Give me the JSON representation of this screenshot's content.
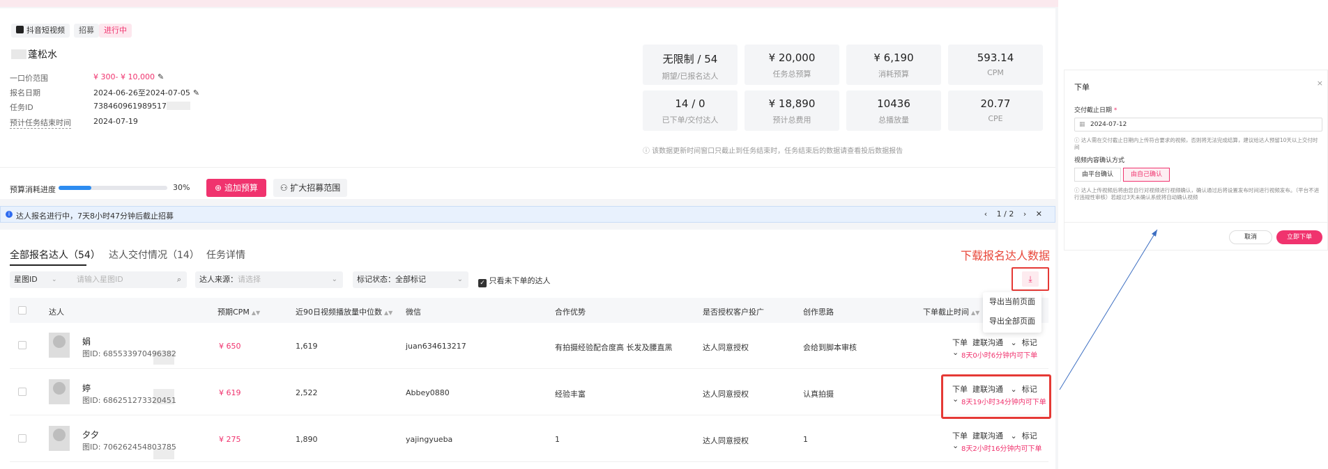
{
  "task": {
    "platform_tag": "抖音短视频",
    "recruit_tag": "招募",
    "status_tag": "进行中",
    "title": "蓬松水",
    "fields": [
      {
        "label": "一口价范围",
        "value": "¥ 300- ¥ 10,000"
      },
      {
        "label": "报名日期",
        "value": "2024-06-26至2024-07-05"
      },
      {
        "label": "任务ID",
        "value": "738460961989517"
      },
      {
        "label": "预计任务结束时间",
        "value": "2024-07-19"
      }
    ]
  },
  "metrics": [
    {
      "value": "无限制 / 54",
      "label": "期望/已报名达人"
    },
    {
      "value": "¥ 20,000",
      "label": "任务总预算"
    },
    {
      "value": "¥ 6,190",
      "label": "消耗预算"
    },
    {
      "value": "593.14",
      "label": "CPM"
    },
    {
      "value": "14 / 0",
      "label": "已下单/交付达人"
    },
    {
      "value": "¥ 18,890",
      "label": "预计总费用"
    },
    {
      "value": "10436",
      "label": "总播放量"
    },
    {
      "value": "20.77",
      "label": "CPE"
    }
  ],
  "metrics_note": "ⓘ 该数据更新时间窗口只截止到任务结束时，任务结束后的数据请查看投后数据报告",
  "progress": {
    "label": "预算消耗进度",
    "percent_value": 30,
    "percent_text": "30%",
    "add_budget_label": "追加预算",
    "expand_label": "扩大招募范围"
  },
  "banner": {
    "text": "达人报名进行中，7天8小时47分钟后截止招募",
    "pager": "1 / 2",
    "prev": "‹",
    "next": "›",
    "close": "✕"
  },
  "tabs": [
    {
      "label": "全部报名达人（54）"
    },
    {
      "label": "达人交付情况（14）"
    },
    {
      "label": "任务详情"
    }
  ],
  "annotation_download": "下载报名达人数据",
  "filters": {
    "star_select": "星图ID",
    "star_placeholder": "请输入星图ID",
    "source_label": "达人来源：",
    "source_placeholder": "请选择",
    "mark_label": "标记状态：全部标记",
    "only_unordered": "只看未下单的达人"
  },
  "export_menu": [
    "导出当前页面",
    "导出全部页面"
  ],
  "columns": [
    "达人",
    "预期CPM",
    "近90日视频播放量中位数",
    "微信",
    "合作优势",
    "是否授权客户投广",
    "创作思路",
    "下单截止时间"
  ],
  "rows": [
    {
      "name": "娟",
      "star_id": "图ID: 685533970496382",
      "cpm": "¥ 650",
      "plays": "1,619",
      "wechat": "juan634613217",
      "advantage": "有拍摄经验配合度高 长发及腰直黑",
      "auth": "达人同意授权",
      "idea": "会给到脚本审核",
      "countdown": "8天0小时6分钟内可下单"
    },
    {
      "name": "婷",
      "star_id": "图ID: 686251273320451",
      "cpm": "¥ 619",
      "plays": "2,522",
      "wechat": "Abbey0880",
      "advantage": "经验丰富",
      "auth": "达人同意授权",
      "idea": "认真拍摄",
      "countdown": "8天19小时34分钟内可下单"
    },
    {
      "name": "夕夕",
      "star_id": "图ID: 706262454803785",
      "cpm": "¥ 275",
      "plays": "1,890",
      "wechat": "yajingyueba",
      "advantage": "1",
      "auth": "达人同意授权",
      "idea": "1",
      "countdown": "8天2小时16分钟内可下单"
    }
  ],
  "row_actions": {
    "order": "下单",
    "contact": "建联沟通",
    "mark": "标记"
  },
  "modal": {
    "title": "下单",
    "close": "×",
    "deadline_label": "交付截止日期",
    "required": "*",
    "deadline_value": "2024-07-12",
    "deadline_note": "ⓘ 达人需在交付截止日期内上传符合要求的视频，否则将无法完成结算，建议给达人预留10天以上交付时间",
    "confirm_mode_label": "视频内容确认方式",
    "options": [
      "由平台确认",
      "由自己确认"
    ],
    "mode_note": "ⓘ 达人上传视频后将由您自行对视频进行视频确认，确认通过后将设置发布时间进行视频发布。（平台不进行违规性审核）若超过3天未确认系统将自动确认视频",
    "cancel": "取消",
    "confirm": "立即下单"
  },
  "colors": {
    "brand": "#f0336e",
    "annotation": "#e53935",
    "info": "#2d8cf0"
  }
}
